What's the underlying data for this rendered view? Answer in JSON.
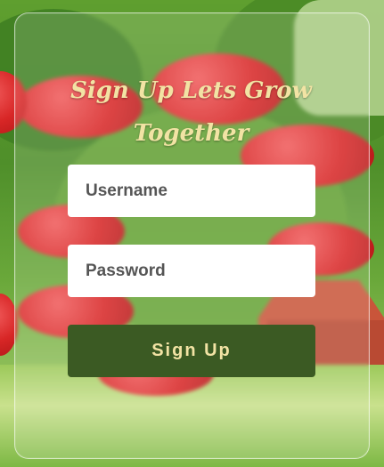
{
  "form": {
    "title": "Sign Up Lets Grow Together",
    "username": {
      "placeholder": "Username",
      "value": ""
    },
    "password": {
      "placeholder": "Password",
      "value": ""
    },
    "submit_label": "Sign Up"
  },
  "colors": {
    "title": "#f2e3a4",
    "button_bg": "#3b5a23",
    "button_text": "#f2e3a4",
    "field_bg": "#ffffff"
  }
}
